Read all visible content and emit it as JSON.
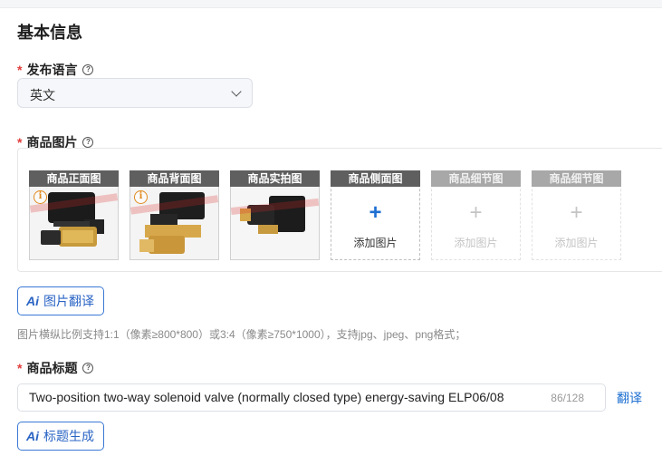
{
  "section": {
    "title": "基本信息"
  },
  "language": {
    "required_mark": "*",
    "label": "发布语言",
    "help_icon": "question-circle-icon",
    "selected": "英文"
  },
  "images": {
    "required_mark": "*",
    "label": "商品图片",
    "help_icon": "question-circle-icon",
    "slots": [
      {
        "title": "商品正面图",
        "state": "filled",
        "warning": true
      },
      {
        "title": "商品背面图",
        "state": "filled",
        "warning": true
      },
      {
        "title": "商品实拍图",
        "state": "filled",
        "warning": false
      },
      {
        "title": "商品侧面图",
        "state": "empty",
        "add_label": "添加图片",
        "plus": "+"
      },
      {
        "title": "商品细节图",
        "state": "disabled",
        "add_label": "添加图片",
        "plus": "+"
      },
      {
        "title": "商品细节图",
        "state": "disabled",
        "add_label": "添加图片",
        "plus": "+"
      }
    ],
    "translate_button": {
      "ai": "Ai",
      "label": "图片翻译"
    },
    "hint": "图片横纵比例支持1:1（像素≥800*800）或3:4（像素≥750*1000），支持jpg、jpeg、png格式；"
  },
  "product_title": {
    "required_mark": "*",
    "label": "商品标题",
    "help_icon": "question-circle-icon",
    "value": "Two-position two-way solenoid valve (normally closed type) energy-saving ELP06/08",
    "counter": "86/128",
    "translate_link": "翻译",
    "generate_button": {
      "ai": "Ai",
      "label": "标题生成"
    }
  },
  "colors": {
    "accent": "#1d6fd1",
    "required": "#e23c3c",
    "slot_header": "#5f5f5f"
  }
}
